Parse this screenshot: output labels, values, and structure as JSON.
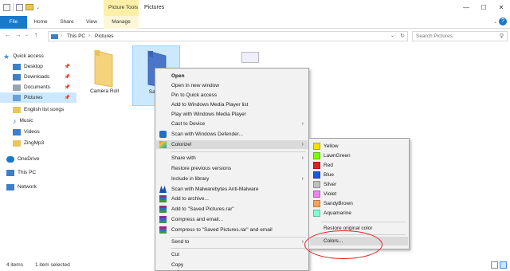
{
  "window": {
    "context_tab_label": "Picture Tools",
    "title": "Pictures",
    "minimize": "—",
    "maximize": "☐",
    "close": "✕"
  },
  "ribbon": {
    "tabs": [
      "File",
      "Home",
      "Share",
      "View",
      "Manage"
    ],
    "expand_icon": "⌄",
    "help": "?"
  },
  "address": {
    "back": "←",
    "forward": "→",
    "recent": "⌄",
    "up": "↑",
    "crumbs": [
      "This PC",
      "Pictures"
    ],
    "separator": "›",
    "dropdown": "⌄",
    "refresh": "↻",
    "search_placeholder": "Search Pictures",
    "search_icon": "⚲"
  },
  "nav": {
    "pin_glyph": "📌",
    "items": [
      {
        "label": "Quick access",
        "icon": "star-icon",
        "color": "#3d8ee0",
        "pinned": false
      },
      {
        "label": "Desktop",
        "icon": "desktop-icon",
        "color": "#3d7fc8",
        "pinned": true
      },
      {
        "label": "Downloads",
        "icon": "download-icon",
        "color": "#3d7fc8",
        "pinned": true
      },
      {
        "label": "Documents",
        "icon": "documents-icon",
        "color": "#9aa4b1",
        "pinned": true
      },
      {
        "label": "Pictures",
        "icon": "pictures-icon",
        "color": "#6a9fd8",
        "pinned": true
      },
      {
        "label": "English list songs",
        "icon": "folder-icon",
        "color": "#e9c65b",
        "pinned": false
      },
      {
        "label": "Music",
        "icon": "music-icon",
        "color": "#3d7fc8",
        "pinned": false
      },
      {
        "label": "Videos",
        "icon": "video-icon",
        "color": "#3d7fc8",
        "pinned": false
      },
      {
        "label": "ZingMp3",
        "icon": "folder-icon",
        "color": "#e9c65b",
        "pinned": false
      },
      {
        "label": "OneDrive",
        "icon": "cloud-icon",
        "color": "#1979ca",
        "pinned": false
      },
      {
        "label": "This PC",
        "icon": "computer-icon",
        "color": "#3d7fc8",
        "pinned": false
      },
      {
        "label": "Network",
        "icon": "network-icon",
        "color": "#3d7fc8",
        "pinned": false
      }
    ]
  },
  "files": [
    {
      "label": "Camera Roll",
      "color": "#f4d37a",
      "selected": false
    },
    {
      "label": "Saved",
      "color": "#4a76c9",
      "selected": true
    }
  ],
  "status": {
    "count": "4 items",
    "selection": "1 item selected"
  },
  "context_menu": {
    "items": [
      "Open",
      "Open in new window",
      "Pin to Quick access",
      "Add to Windows Media Player list",
      "Play with Windows Media Player",
      "Cast to Device",
      "Scan with Windows Defender...",
      "Colorize!",
      "Share with",
      "Restore previous versions",
      "Include in library",
      "Scan with Malwarebytes Anti-Malware",
      "Add to archive...",
      "Add to \"Saved Pictures.rar\"",
      "Compress and email...",
      "Compress to \"Saved Pictures.rar\" and email",
      "Send to",
      "Cut",
      "Copy"
    ],
    "arrow": "›"
  },
  "colorize_menu": {
    "colors": [
      {
        "label": "Yellow",
        "swatch": "#f2e200"
      },
      {
        "label": "LawnGreen",
        "swatch": "#7cfc00"
      },
      {
        "label": "Red",
        "swatch": "#e02020"
      },
      {
        "label": "Blue",
        "swatch": "#2457d8"
      },
      {
        "label": "Silver",
        "swatch": "#c0c0c0"
      },
      {
        "label": "Violet",
        "swatch": "#ee82ee"
      },
      {
        "label": "SandyBrown",
        "swatch": "#f4a460"
      },
      {
        "label": "Aquamarine",
        "swatch": "#7fffd4"
      }
    ],
    "restore_label": "Restore original color",
    "more_label": "Colors..."
  },
  "accent_colors": {
    "file_tab": "#1979ca",
    "selection": "#cce8ff",
    "annotation_ring": "#e21f26"
  }
}
